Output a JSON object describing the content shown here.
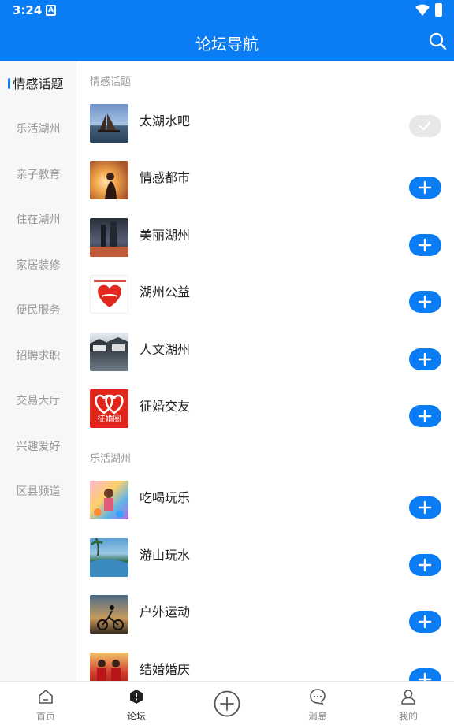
{
  "status_bar": {
    "time": "3:24",
    "notification_icon": "A"
  },
  "header": {
    "title": "论坛导航",
    "search_icon": "search-icon"
  },
  "sidebar": {
    "items": [
      {
        "label": "情感话题",
        "active": true
      },
      {
        "label": "乐活湖州",
        "active": false
      },
      {
        "label": "亲子教育",
        "active": false
      },
      {
        "label": "住在湖州",
        "active": false
      },
      {
        "label": "家居装修",
        "active": false
      },
      {
        "label": "便民服务",
        "active": false
      },
      {
        "label": "招聘求职",
        "active": false
      },
      {
        "label": "交易大厅",
        "active": false
      },
      {
        "label": "兴趣爱好",
        "active": false
      },
      {
        "label": "区县频道",
        "active": false
      }
    ]
  },
  "sections": [
    {
      "title": "情感话题",
      "forums": [
        {
          "name": "太湖水吧",
          "joined": true
        },
        {
          "name": "情感都市",
          "joined": false
        },
        {
          "name": "美丽湖州",
          "joined": false
        },
        {
          "name": "湖州公益",
          "joined": false
        },
        {
          "name": "人文湖州",
          "joined": false
        },
        {
          "name": "征婚交友",
          "joined": false,
          "logo_text": "征婚圈"
        }
      ]
    },
    {
      "title": "乐活湖州",
      "forums": [
        {
          "name": "吃喝玩乐",
          "joined": false
        },
        {
          "name": "游山玩水",
          "joined": false
        },
        {
          "name": "户外运动",
          "joined": false
        },
        {
          "name": "结婚婚庆",
          "joined": false
        }
      ]
    }
  ],
  "bottom_nav": {
    "tabs": [
      {
        "label": "首页",
        "icon": "home-icon",
        "active": false
      },
      {
        "label": "论坛",
        "icon": "forum-icon",
        "active": true
      },
      {
        "label": "",
        "icon": "add-post-icon",
        "active": false
      },
      {
        "label": "消息",
        "icon": "message-icon",
        "active": false
      },
      {
        "label": "我的",
        "icon": "profile-icon",
        "active": false
      }
    ]
  },
  "colors": {
    "primary": "#0a7df5",
    "joined_button": "#e8e8e8",
    "sidebar_bg": "#f7f7f7"
  }
}
